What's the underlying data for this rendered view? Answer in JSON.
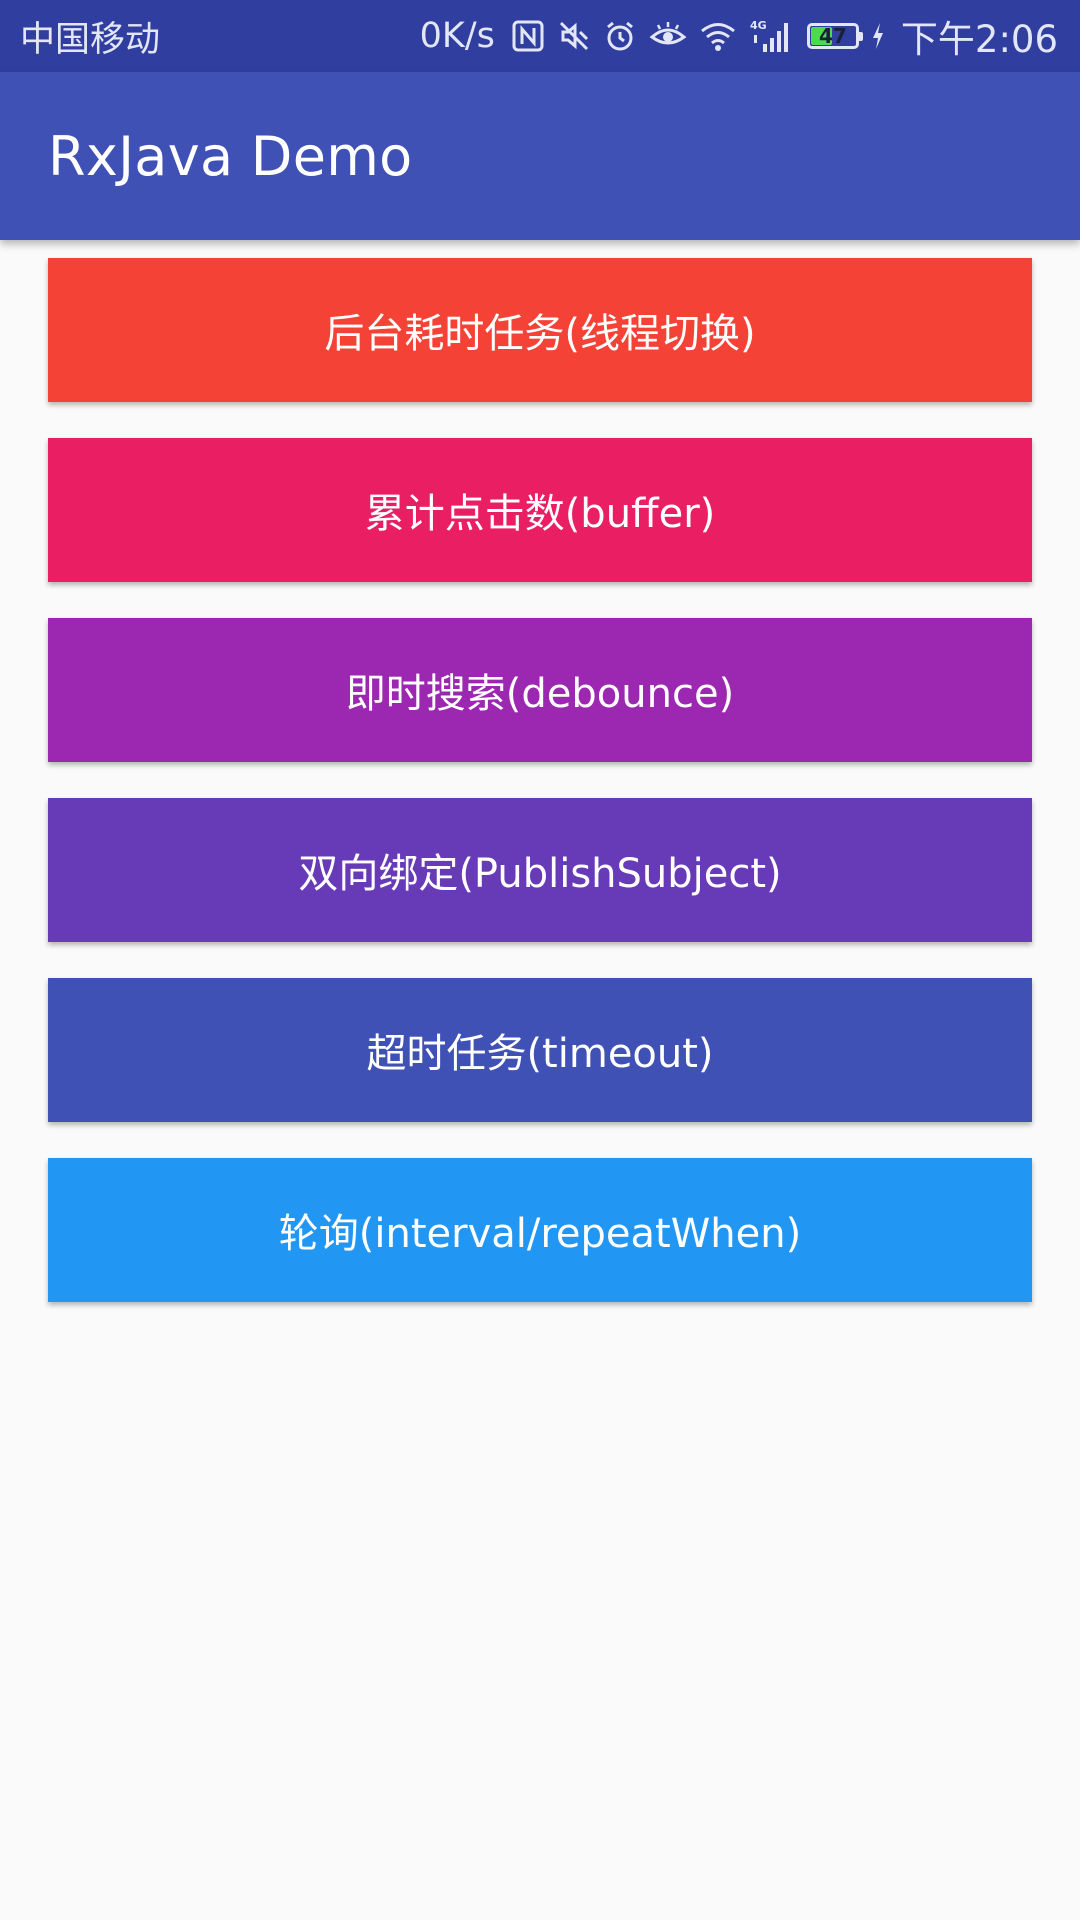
{
  "status_bar": {
    "carrier": "中国移动",
    "net_speed": "0K/s",
    "network_type": "4G",
    "battery_level": "47",
    "time": "下午2:06",
    "icons": [
      "nfc-icon",
      "mute-icon",
      "alarm-icon",
      "eye-comfort-icon",
      "wifi-icon",
      "signal-icon",
      "battery-icon",
      "charging-icon"
    ],
    "background_color": "#303f9f"
  },
  "app_bar": {
    "title": "RxJava Demo",
    "background_color": "#3f51b5"
  },
  "buttons": [
    {
      "label": "后台耗时任务(线程切换)",
      "color": "#f44336"
    },
    {
      "label": "累计点击数(buffer)",
      "color": "#e91e63"
    },
    {
      "label": "即时搜索(debounce)",
      "color": "#9c27b0"
    },
    {
      "label": "双向绑定(PublishSubject)",
      "color": "#673ab7"
    },
    {
      "label": "超时任务(timeout)",
      "color": "#3f51b5"
    },
    {
      "label": "轮询(interval/repeatWhen)",
      "color": "#2196f3"
    }
  ]
}
